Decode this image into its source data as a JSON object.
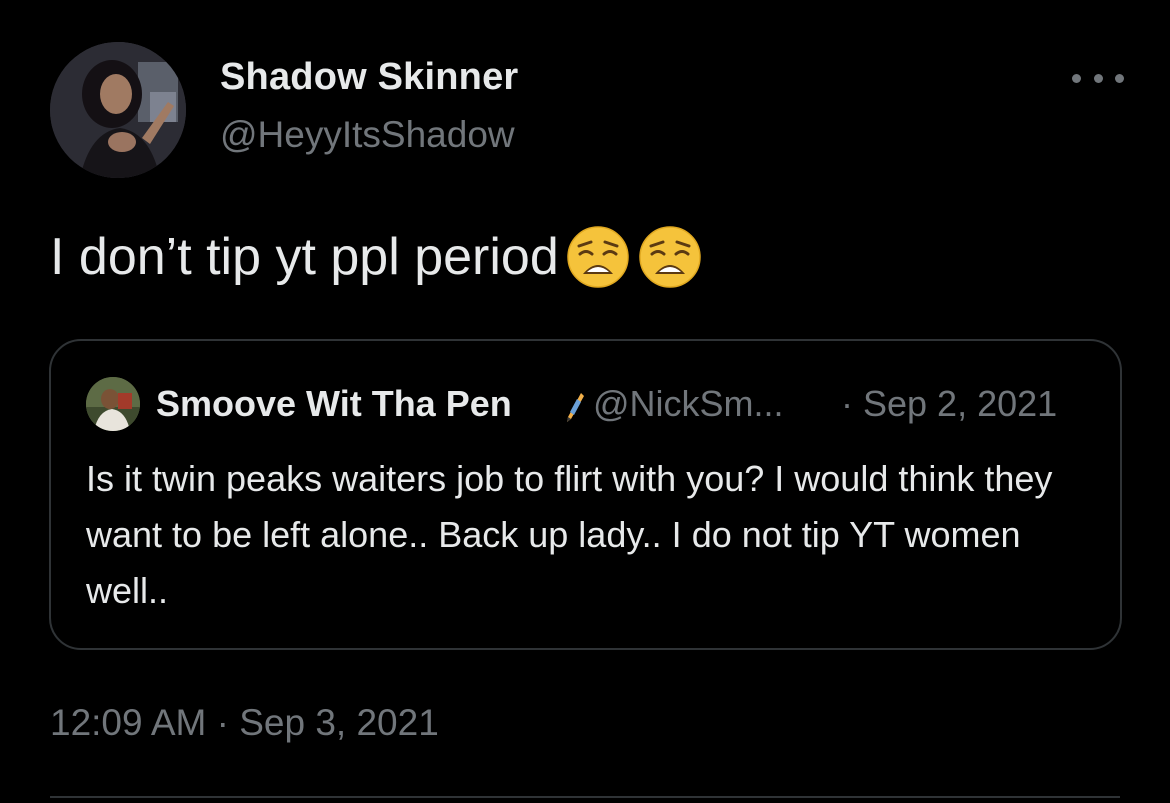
{
  "tweet": {
    "author": {
      "display_name": "Shadow Skinner",
      "handle": "@HeyyItsShadow",
      "avatar_icon": "profile-photo"
    },
    "more_icon": "more-horizontal-icon",
    "text": "I don’t tip yt ppl period",
    "emojis": [
      "😩",
      "😩"
    ],
    "timestamp": "12:09 AM · Sep 3, 2021"
  },
  "quote": {
    "author": {
      "display_name": "Smoove Wit Tha Pen",
      "handle": "@NickSm...",
      "badge_icon": "pen-icon",
      "avatar_icon": "profile-photo"
    },
    "separator": "·",
    "date": "Sep 2, 2021",
    "text": "Is it twin peaks waiters job to flirt with you? I would think they want to be left alone.. Back up lady.. I do not tip YT women well.."
  },
  "colors": {
    "background": "#000000",
    "primary_text": "#e7e9ea",
    "secondary_text": "#71767b",
    "border": "#2f3336"
  }
}
